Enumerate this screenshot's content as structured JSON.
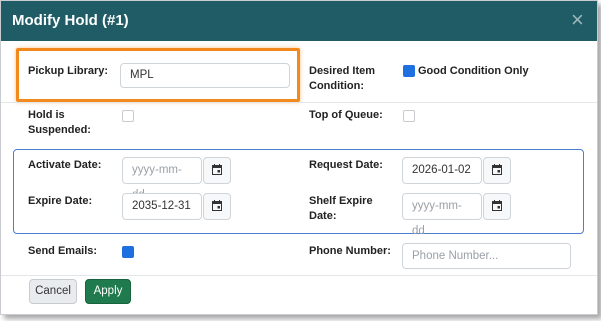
{
  "dialog": {
    "title": "Modify Hold (#1)",
    "close_glyph": "×"
  },
  "fields": {
    "pickup_library": {
      "label": "Pickup Library:",
      "value": "MPL"
    },
    "desired_condition": {
      "label_line1": "Desired Item",
      "label_line2": "Condition:",
      "option_label": "Good Condition Only",
      "checked": true
    },
    "hold_suspended": {
      "label_line1": "Hold is",
      "label_line2": "Suspended:",
      "checked": false
    },
    "top_of_queue": {
      "label": "Top of Queue:",
      "checked": false
    },
    "activate_date": {
      "label": "Activate Date:",
      "placeholder": "yyyy-mm-dd",
      "value": ""
    },
    "request_date": {
      "label": "Request Date:",
      "value": "2026-01-02"
    },
    "expire_date": {
      "label": "Expire Date:",
      "value": "2035-12-31"
    },
    "shelf_expire_date": {
      "label_line1": "Shelf Expire",
      "label_line2": "Date:",
      "placeholder": "yyyy-mm-dd",
      "value": ""
    },
    "send_emails": {
      "label": "Send Emails:",
      "checked": true
    },
    "phone_number": {
      "label": "Phone Number:",
      "placeholder": "Phone Number...",
      "value": ""
    }
  },
  "buttons": {
    "cancel": "Cancel",
    "apply": "Apply"
  },
  "icons": {
    "date_picker": "calendar-icon",
    "close": "close-icon"
  },
  "colors": {
    "header": "#1f5c66",
    "checkbox_on": "#1e6fe0",
    "apply": "#1f7a4d",
    "highlight": "#f1891d",
    "date_group_border": "#4b7fcf"
  }
}
